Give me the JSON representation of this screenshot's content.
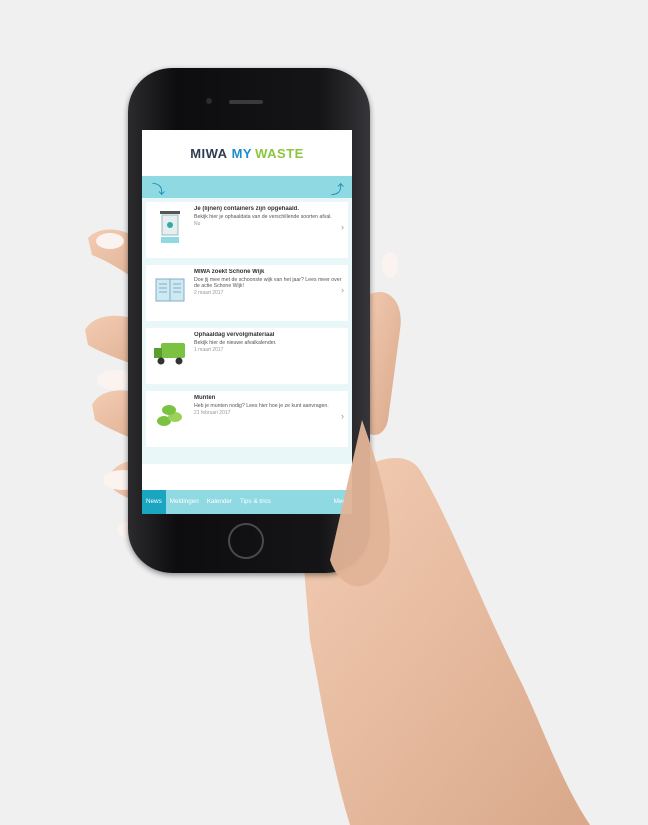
{
  "app": {
    "logo": {
      "part1": "MIWA",
      "part2": "MY",
      "part3": "WASTE"
    }
  },
  "cards": [
    {
      "title": "Je (lijnen) containers zijn opgehaald.",
      "body": "Bekijk hier je ophaaldata van de verschillende soorten afval.",
      "date": "Nu",
      "icon": "container-icon"
    },
    {
      "title": "MIWA zoekt Schone Wijk",
      "body": "Doe jij mee met de schoonste wijk van het jaar? Lees meer over de actie Schone Wijk!",
      "date": "2 maart 2017",
      "icon": "newspaper-icon"
    },
    {
      "title": "Ophaaldag vervolgmateriaal",
      "body": "Bekijk hier de nieuwe afvalkalender.",
      "date": "1 maart 2017",
      "icon": "garbage-truck-icon"
    },
    {
      "title": "Munten",
      "body": "Heb je munten nodig? Lees hier hoe je ze kunt aanvragen.",
      "date": "21 februari 2017",
      "icon": "coins-icon"
    }
  ],
  "tabs": [
    {
      "label": "News",
      "active": true
    },
    {
      "label": "Meldingen",
      "active": false
    },
    {
      "label": "Kalender",
      "active": false
    },
    {
      "label": "Tips & trics",
      "active": false
    },
    {
      "label": "Meer",
      "active": false
    }
  ],
  "colors": {
    "accent": "#8fd9e2",
    "active_tab": "#1aa5c0",
    "logo_blue": "#1f8ad1",
    "logo_green": "#8cc63f"
  }
}
